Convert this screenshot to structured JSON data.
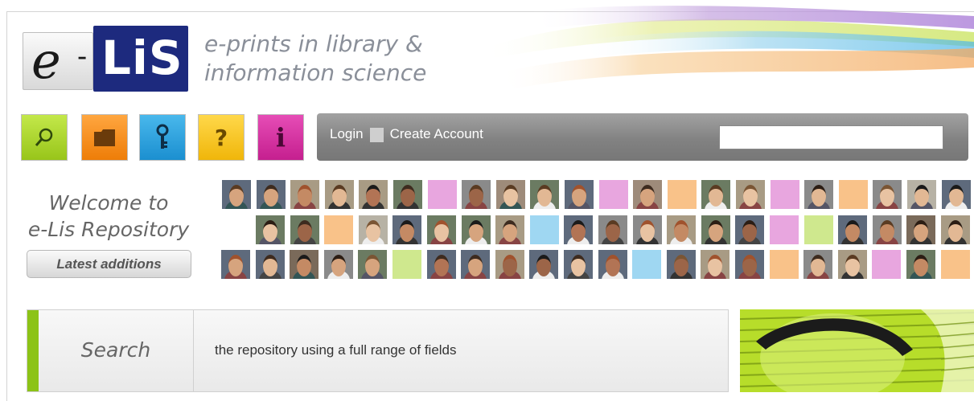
{
  "header": {
    "logo_text": "e-LiS",
    "tagline": "e-prints in library &\ninformation science"
  },
  "toolbar": [
    {
      "name": "search-tool",
      "icon": "magnifier-icon",
      "color": "#a6d21e"
    },
    {
      "name": "browse-tool",
      "icon": "folder-icon",
      "color": "#f08a10"
    },
    {
      "name": "login-tool",
      "icon": "key-icon",
      "color": "#1e9cdb"
    },
    {
      "name": "help-tool",
      "icon": "question-icon",
      "color": "#f3c31b"
    },
    {
      "name": "info-tool",
      "icon": "info-icon",
      "color": "#d02f9e"
    }
  ],
  "nav": {
    "login": "Login",
    "create_account": "Create Account",
    "search_value": ""
  },
  "welcome": {
    "line1": "Welcome to",
    "line2": "e-Lis Repository",
    "latest_button": "Latest additions"
  },
  "search_panel": {
    "label": "Search",
    "description": "the repository using a full range of fields"
  },
  "colors": {
    "accent_green": "#8cc317",
    "navbar_gray": "#8a8a8a",
    "logo_blue": "#1d2a7e"
  }
}
